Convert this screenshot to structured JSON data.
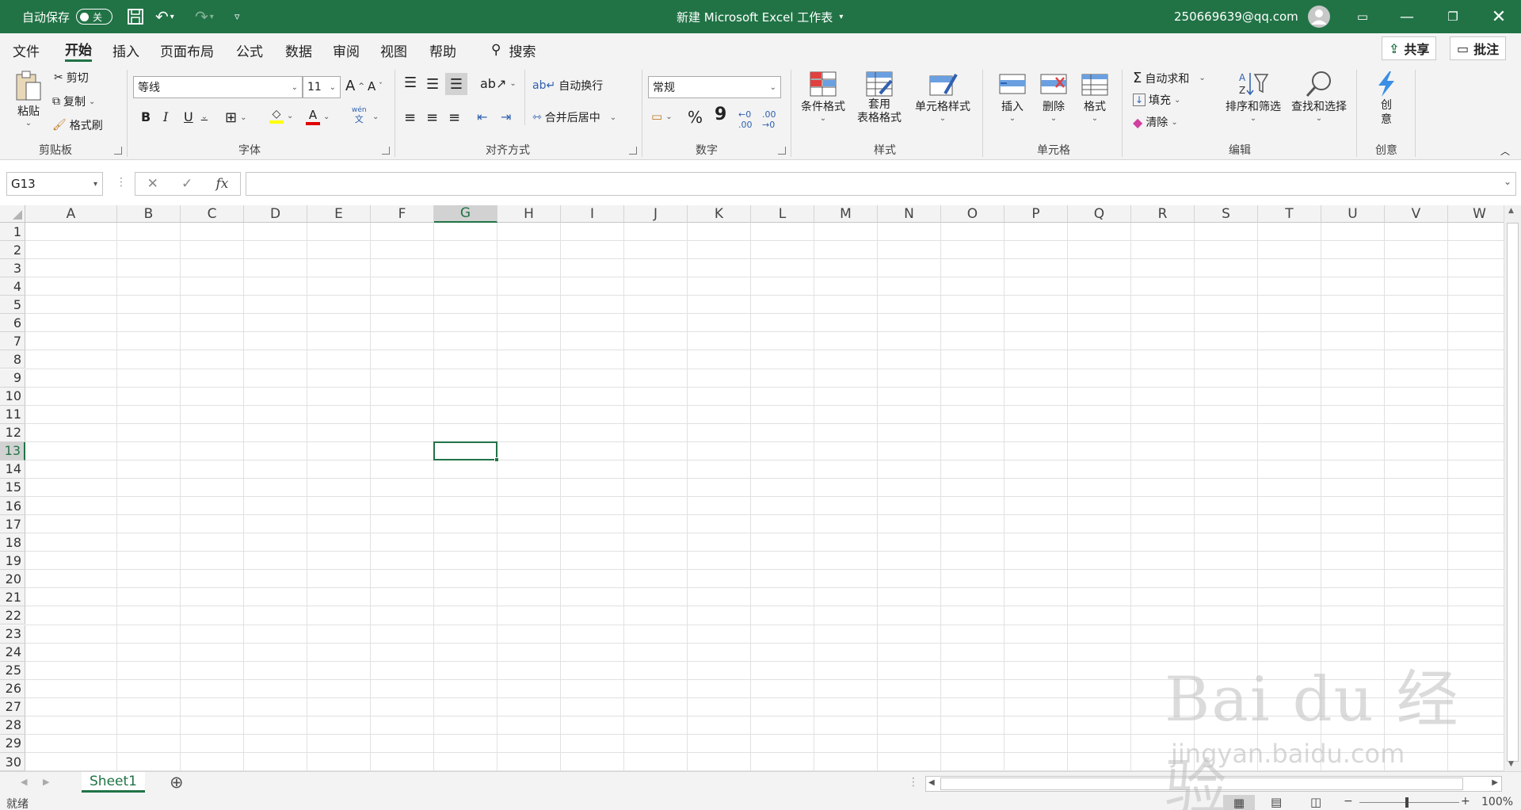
{
  "titlebar": {
    "autosave_label": "自动保存",
    "autosave_state": "关",
    "doc_title": "新建 Microsoft Excel 工作表",
    "account": "250669639@qq.com"
  },
  "menu": {
    "tabs": [
      "文件",
      "开始",
      "插入",
      "页面布局",
      "公式",
      "数据",
      "审阅",
      "视图",
      "帮助"
    ],
    "active_tab": "开始",
    "search": "搜索",
    "share": "共享",
    "comments": "批注"
  },
  "ribbon": {
    "clipboard": {
      "paste": "粘贴",
      "cut": "剪切",
      "copy": "复制",
      "format_painter": "格式刷",
      "label": "剪贴板"
    },
    "font": {
      "name": "等线",
      "size": "11",
      "bold": "B",
      "italic": "I",
      "underline": "U",
      "grow": "A",
      "shrink": "A",
      "phonetic": "wén",
      "phonetic2": "文",
      "color_letter": "A",
      "label": "字体"
    },
    "alignment": {
      "wrap": "自动换行",
      "merge": "合并后居中",
      "label": "对齐方式"
    },
    "number": {
      "format": "常规",
      "percent": "%",
      "comma": "9",
      "inc": "←0 .00",
      "dec": ".00 →0",
      "label": "数字"
    },
    "styles": {
      "conditional": "条件格式",
      "table1": "套用",
      "table2": "表格格式",
      "cell_styles": "单元格样式",
      "label": "样式"
    },
    "cells": {
      "insert": "插入",
      "delete": "删除",
      "format": "格式",
      "label": "单元格"
    },
    "editing": {
      "autosum": "自动求和",
      "fill": "填充",
      "clear": "清除",
      "sort": "排序和筛选",
      "find": "查找和选择",
      "label": "编辑"
    },
    "ideas": {
      "btn1": "创",
      "btn2": "意",
      "label": "创意"
    }
  },
  "formula": {
    "cell_ref": "G13",
    "fx": "fx",
    "content": ""
  },
  "grid": {
    "columns": [
      "A",
      "B",
      "C",
      "D",
      "E",
      "F",
      "G",
      "H",
      "I",
      "J",
      "K",
      "L",
      "M",
      "N",
      "O",
      "P",
      "Q",
      "R",
      "S",
      "T",
      "U",
      "V",
      "W"
    ],
    "rows": [
      "1",
      "2",
      "3",
      "4",
      "5",
      "6",
      "7",
      "8",
      "9",
      "10",
      "11",
      "12",
      "13",
      "14",
      "15",
      "16",
      "17",
      "18",
      "19",
      "20",
      "21",
      "22",
      "23",
      "24",
      "25",
      "26",
      "27",
      "28",
      "29",
      "30"
    ],
    "active_col": "G",
    "active_row": "13"
  },
  "sheets": {
    "tabs": [
      "Sheet1"
    ],
    "add": "⊕"
  },
  "status": {
    "ready": "就绪",
    "zoom": "100%"
  },
  "watermark": {
    "logo": "Bai du 经验",
    "url": "jingyan.baidu.com"
  },
  "colors": {
    "brand": "#217346",
    "ribbon_bg": "#f3f3f3"
  }
}
